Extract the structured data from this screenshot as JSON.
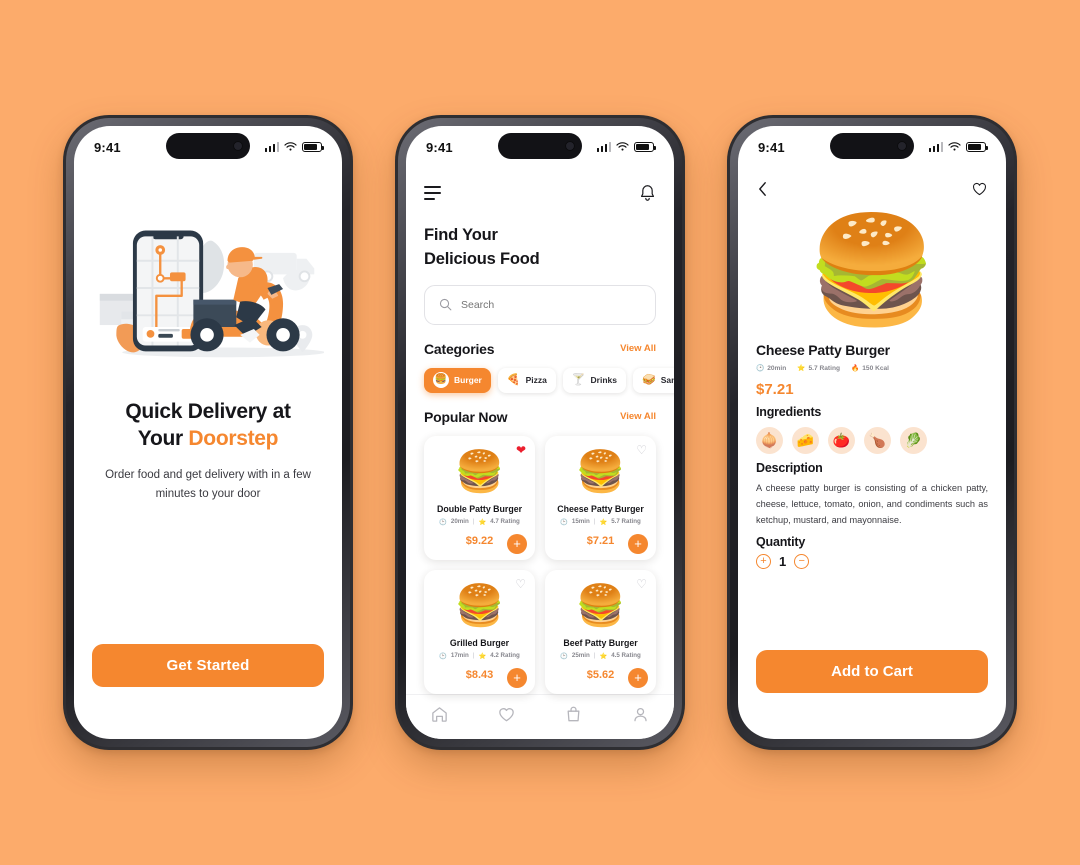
{
  "theme": {
    "background": "#fcab6b",
    "accent": "#f5872f",
    "text_dark": "#16161a",
    "fav_red": "#ec1f2e"
  },
  "status_bar": {
    "time": "9:41",
    "signal_icon": "signal-bars-icon",
    "wifi_icon": "wifi-icon",
    "battery_icon": "battery-icon"
  },
  "screen1": {
    "illustration": "delivery-scooter-illustration",
    "headline_line1": "Quick Delivery at",
    "headline_line2_plain": "Your ",
    "headline_line2_accent": "Doorstep",
    "subtext": "Order food and get delivery with in a few minutes to your door",
    "cta_label": "Get Started"
  },
  "screen2": {
    "menu_icon": "hamburger-menu-icon",
    "bell_icon": "notification-bell-icon",
    "title_line1": "Find Your",
    "title_line2": "Delicious Food",
    "search": {
      "placeholder": "Search",
      "value": "",
      "icon": "search-icon"
    },
    "categories_header": "Categories",
    "categories_view_all": "View All",
    "categories": [
      {
        "label": "Burger",
        "emoji": "🍔",
        "active": true
      },
      {
        "label": "Pizza",
        "emoji": "🍕",
        "active": false
      },
      {
        "label": "Drinks",
        "emoji": "🍸",
        "active": false
      },
      {
        "label": "Sandwich",
        "emoji": "🥪",
        "active": false
      }
    ],
    "popular_header": "Popular Now",
    "popular_view_all": "View All",
    "items": [
      {
        "name": "Double Patty Burger",
        "time": "20min",
        "rating": "4.7 Rating",
        "price": "$9.22",
        "emoji": "🍔",
        "favorite": true
      },
      {
        "name": "Cheese Patty Burger",
        "time": "15min",
        "rating": "5.7 Rating",
        "price": "$7.21",
        "emoji": "🍔",
        "favorite": false
      },
      {
        "name": "Grilled Burger",
        "time": "17min",
        "rating": "4.2 Rating",
        "price": "$8.43",
        "emoji": "🍔",
        "favorite": false
      },
      {
        "name": "Beef Patty Burger",
        "time": "25min",
        "rating": "4.5 Rating",
        "price": "$5.62",
        "emoji": "🍔",
        "favorite": false
      }
    ],
    "tabs": [
      {
        "name": "home-tab",
        "icon": "home-icon"
      },
      {
        "name": "favorite-tab",
        "icon": "heart-icon"
      },
      {
        "name": "bag-tab",
        "icon": "shopping-bag-icon"
      },
      {
        "name": "profile-tab",
        "icon": "person-icon"
      }
    ]
  },
  "screen3": {
    "back_icon": "chevron-left-icon",
    "favorite_icon": "heart-outline-icon",
    "hero_emoji": "🍔",
    "product_name": "Cheese Patty Burger",
    "meta": {
      "time": "20min",
      "rating": "5.7 Rating",
      "calories": "150 Kcal"
    },
    "price": "$7.21",
    "ingredients_header": "Ingredients",
    "ingredients": [
      {
        "name": "onion",
        "emoji": "🧅"
      },
      {
        "name": "cheese",
        "emoji": "🧀"
      },
      {
        "name": "tomato",
        "emoji": "🍅"
      },
      {
        "name": "chicken-leg",
        "emoji": "🍗"
      },
      {
        "name": "lettuce",
        "emoji": "🥬"
      }
    ],
    "description_header": "Description",
    "description": "A cheese patty burger is consisting of a chicken patty, cheese, lettuce, tomato, onion, and condiments such as ketchup, mustard, and mayonnaise.",
    "quantity_header": "Quantity",
    "quantity_value": "1",
    "increase_label": "+",
    "decrease_label": "−",
    "cta_label": "Add to Cart"
  }
}
